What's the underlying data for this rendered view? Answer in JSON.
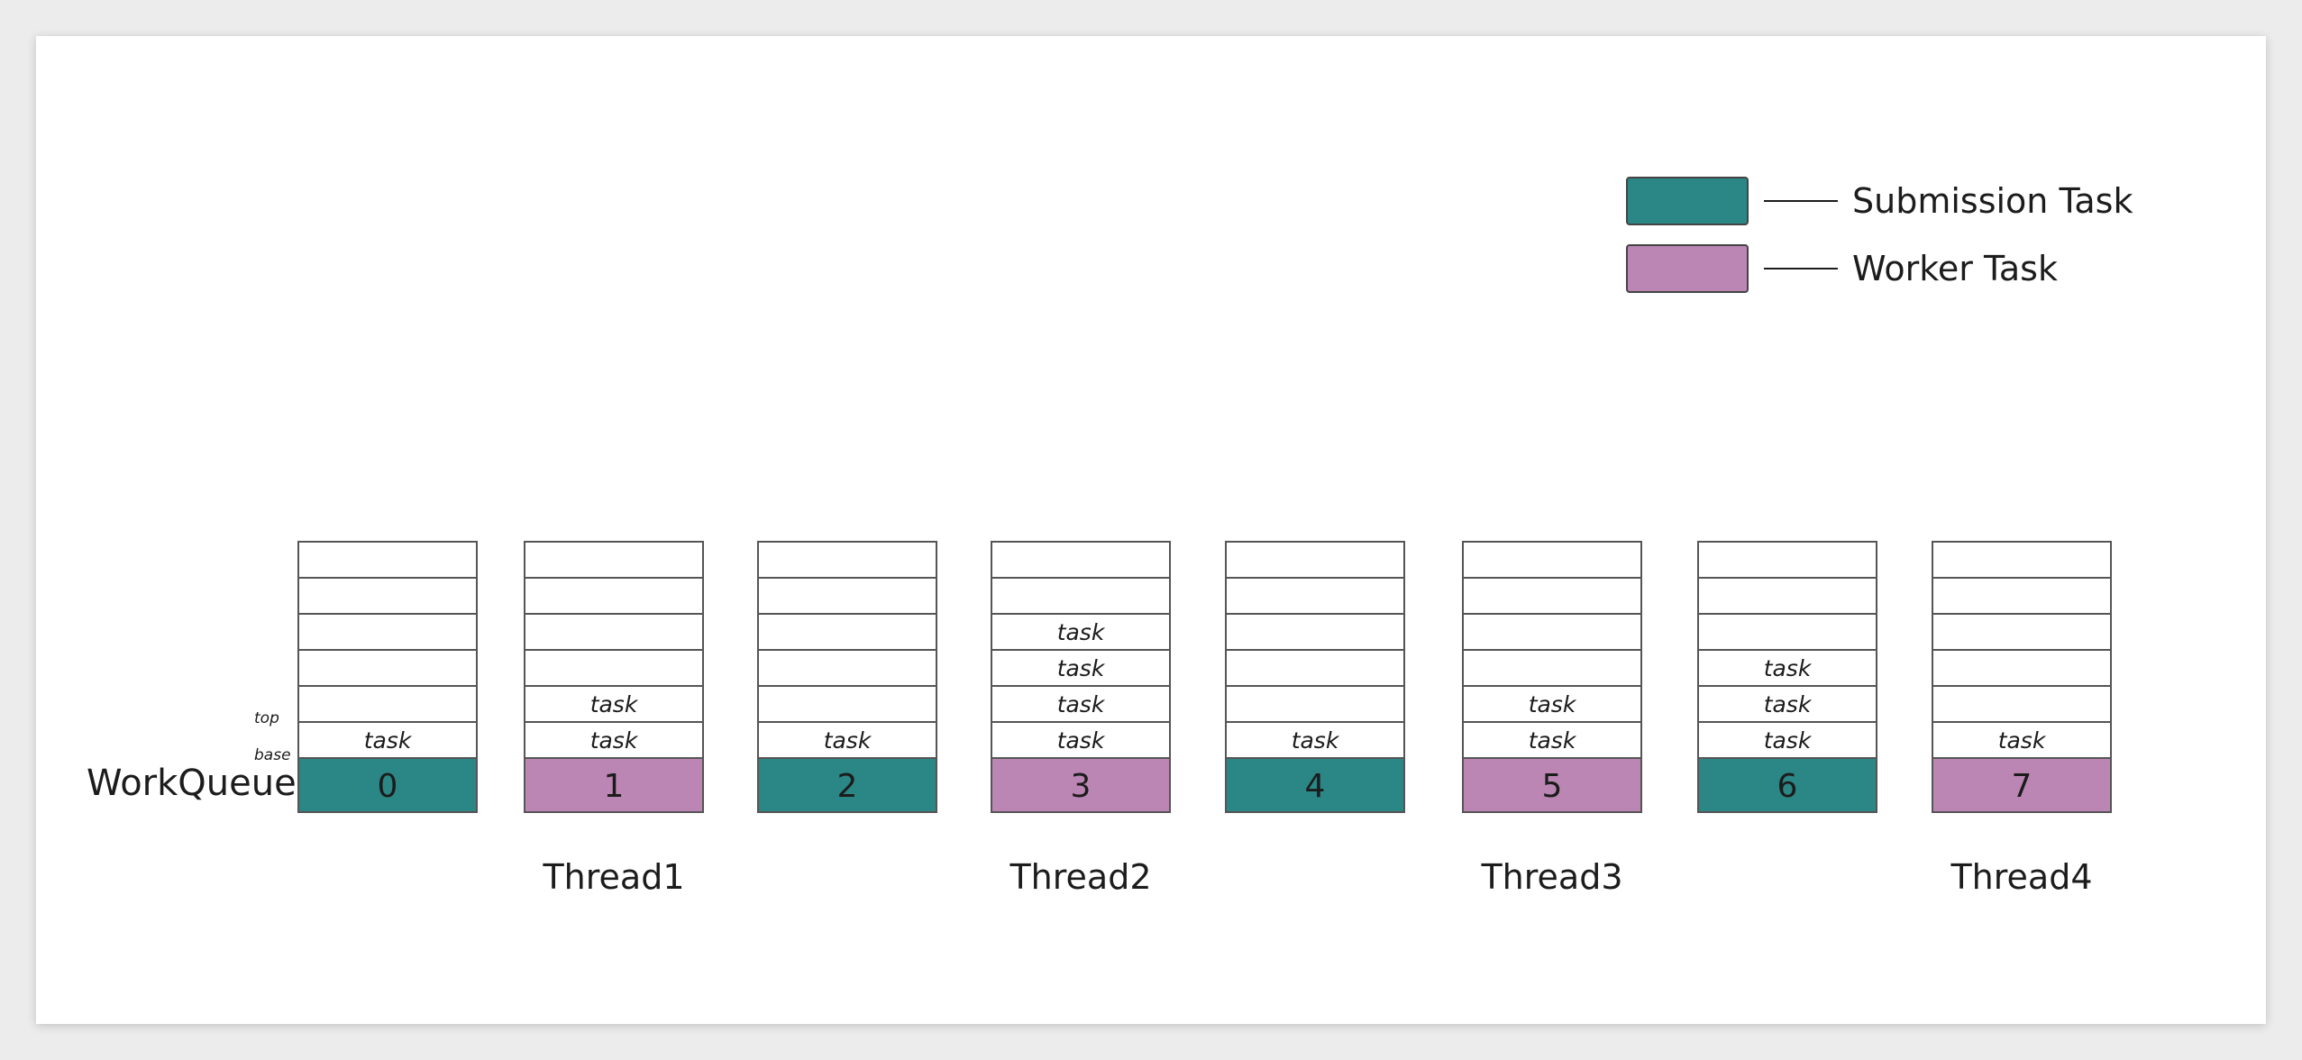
{
  "colors": {
    "submission": "#2b8686",
    "worker": "#bc86b4"
  },
  "legend": [
    {
      "kind": "submission",
      "label": "Submission Task"
    },
    {
      "kind": "worker",
      "label": "Worker Task"
    }
  ],
  "labels": {
    "workqueue": "WorkQueue[]",
    "top": "top",
    "base": "base"
  },
  "task_label": "task",
  "queues": [
    {
      "index": "0",
      "kind": "submission",
      "tasks": 1
    },
    {
      "index": "1",
      "kind": "worker",
      "tasks": 2
    },
    {
      "index": "2",
      "kind": "submission",
      "tasks": 1
    },
    {
      "index": "3",
      "kind": "worker",
      "tasks": 4
    },
    {
      "index": "4",
      "kind": "submission",
      "tasks": 1
    },
    {
      "index": "5",
      "kind": "worker",
      "tasks": 2
    },
    {
      "index": "6",
      "kind": "submission",
      "tasks": 3
    },
    {
      "index": "7",
      "kind": "worker",
      "tasks": 1
    }
  ],
  "threads": [
    {
      "label": "Thread1",
      "queue": "1"
    },
    {
      "label": "Thread2",
      "queue": "3"
    },
    {
      "label": "Thread3",
      "queue": "5"
    },
    {
      "label": "Thread4",
      "queue": "7"
    }
  ]
}
